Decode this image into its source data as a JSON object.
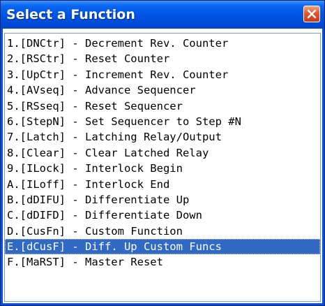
{
  "window": {
    "title": "Select a Function",
    "close_icon": "close-x-icon",
    "colors": {
      "titlebar": "#0055e5",
      "close_button": "#e2572f",
      "selection": "#316ac5"
    }
  },
  "list": {
    "selected_index": 14,
    "items": [
      {
        "label": "1.[DNCtr] - Decrement Rev. Counter"
      },
      {
        "label": "2.[RSCtr] - Reset Counter"
      },
      {
        "label": "3.[UpCtr] - Increment Rev. Counter"
      },
      {
        "label": "4.[AVseq] - Advance Sequencer"
      },
      {
        "label": "5.[RSseq] - Reset Sequencer"
      },
      {
        "label": "6.[StepN] - Set Sequencer to Step #N"
      },
      {
        "label": "7.[Latch] - Latching Relay/Output"
      },
      {
        "label": "8.[Clear] - Clear Latched Relay"
      },
      {
        "label": "9.[ILock] - Interlock Begin"
      },
      {
        "label": "A.[ILoff] - Interlock End"
      },
      {
        "label": "B.[dDIFU] - Differentiate Up"
      },
      {
        "label": "C.[dDIFD] - Differentiate Down"
      },
      {
        "label": "D.[CusFn] - Custom Function"
      },
      {
        "label": "E.[dCusF] - Diff. Up Custom Funcs"
      },
      {
        "label": "F.[MaRST] - Master Reset"
      }
    ]
  }
}
